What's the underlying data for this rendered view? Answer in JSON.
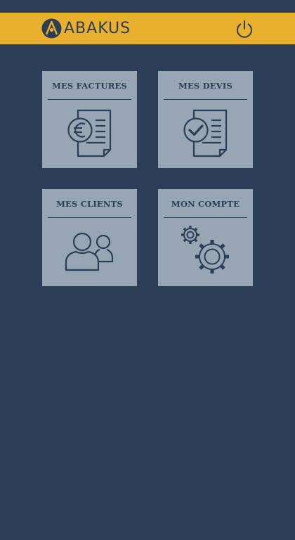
{
  "header": {
    "logo_text": "ABAKUS",
    "logo_icon": "abakus-logo-icon",
    "power_icon": "power-icon",
    "bar_color": "#e8b02c"
  },
  "tiles": [
    {
      "label": "MES FACTURES",
      "icon": "invoice-euro-icon"
    },
    {
      "label": "MES DEVIS",
      "icon": "quote-check-icon"
    },
    {
      "label": "MES CLIENTS",
      "icon": "users-icon"
    },
    {
      "label": "MON COMPTE",
      "icon": "gears-icon"
    }
  ],
  "colors": {
    "background": "#2c3e55",
    "tile": "#98a5b4",
    "accent": "#e8b02c"
  }
}
